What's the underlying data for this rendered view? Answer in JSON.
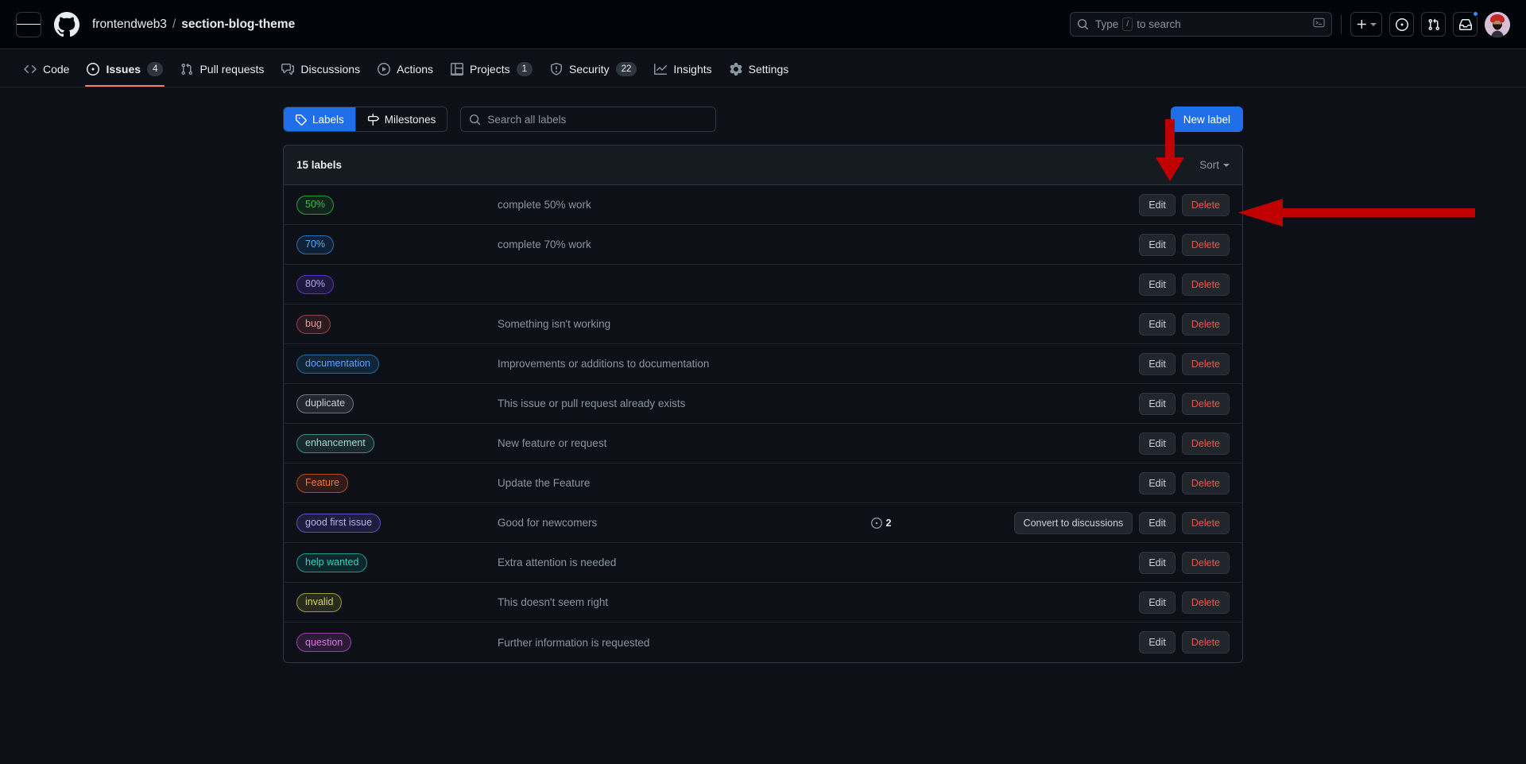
{
  "header": {
    "menu_icon": "hamburger-icon",
    "logo_icon": "github-mark-icon",
    "owner": "frontendweb3",
    "separator": "/",
    "repo": "section-blog-theme",
    "search": {
      "placeholder_prefix": "Type",
      "slash_key": "/",
      "placeholder_suffix": "to search",
      "terminal_icon": "terminal-chevron-icon"
    },
    "actions": {
      "create_new_icon": "plus-icon",
      "create_new_caret": "chevron-down-icon",
      "issues_icon": "issue-opened-icon",
      "pull_requests_icon": "git-pull-request-icon",
      "notifications_icon": "inbox-icon",
      "notification_badge": true,
      "avatar_icon": "user-avatar"
    }
  },
  "repo_nav": {
    "tabs": [
      {
        "label": "Code",
        "icon": "code-icon",
        "count": null,
        "active": false
      },
      {
        "label": "Issues",
        "icon": "issue-opened-icon",
        "count": "4",
        "active": true
      },
      {
        "label": "Pull requests",
        "icon": "git-pull-request-icon",
        "count": null,
        "active": false
      },
      {
        "label": "Discussions",
        "icon": "comment-discussion-icon",
        "count": null,
        "active": false
      },
      {
        "label": "Actions",
        "icon": "play-icon",
        "count": null,
        "active": false
      },
      {
        "label": "Projects",
        "icon": "table-icon",
        "count": "1",
        "active": false
      },
      {
        "label": "Security",
        "icon": "shield-icon",
        "count": "22",
        "active": false
      },
      {
        "label": "Insights",
        "icon": "graph-icon",
        "count": null,
        "active": false
      },
      {
        "label": "Settings",
        "icon": "gear-icon",
        "count": null,
        "active": false
      }
    ]
  },
  "toolbar": {
    "labels_tab": "Labels",
    "labels_icon": "tag-icon",
    "milestones_tab": "Milestones",
    "milestones_icon": "milestone-icon",
    "search_placeholder": "Search all labels",
    "search_icon": "search-icon",
    "search_value": "",
    "new_label_button": "New label"
  },
  "panel": {
    "count_text": "15 labels",
    "sort_label": "Sort",
    "sort_caret_icon": "chevron-down-icon"
  },
  "buttons": {
    "edit": "Edit",
    "delete": "Delete",
    "convert": "Convert to discussions"
  },
  "colors": {
    "accent_blue": "#1f6feb",
    "danger_red": "#f85149",
    "active_tab_underline": "#f78166",
    "annotation_red": "#c00000",
    "page_bg": "#0d1117",
    "header_bg": "#010409",
    "border": "#30363d"
  },
  "labels": [
    {
      "name": "50%",
      "description": "complete 50% work",
      "color": "#19a337",
      "text": "#3fb950",
      "bg": "rgba(25,163,55,0.14)",
      "issue_count": null,
      "convertible": false
    },
    {
      "name": "70%",
      "description": "complete 70% work",
      "color": "#1f6fc4",
      "text": "#58a6ff",
      "bg": "rgba(31,111,196,0.18)",
      "issue_count": null,
      "convertible": false
    },
    {
      "name": "80%",
      "description": "",
      "color": "#5a32c4",
      "text": "#b8a6f0",
      "bg": "rgba(90,50,196,0.22)",
      "issue_count": null,
      "convertible": false
    },
    {
      "name": "bug",
      "description": "Something isn't working",
      "color": "#96414a",
      "text": "#e09aa0",
      "bg": "rgba(150,65,74,0.22)",
      "issue_count": null,
      "convertible": false
    },
    {
      "name": "documentation",
      "description": "Improvements or additions to documentation",
      "color": "#1a6ea8",
      "text": "#58a6ff",
      "bg": "rgba(26,110,168,0.22)",
      "issue_count": null,
      "convertible": false
    },
    {
      "name": "duplicate",
      "description": "This issue or pull request already exists",
      "color": "#70777f",
      "text": "#c9d1d9",
      "bg": "rgba(112,119,127,0.22)",
      "issue_count": null,
      "convertible": false
    },
    {
      "name": "enhancement",
      "description": "New feature or request",
      "color": "#3f8a86",
      "text": "#a5d6d3",
      "bg": "rgba(63,138,134,0.20)",
      "issue_count": null,
      "convertible": false
    },
    {
      "name": "Feature",
      "description": "Update the Feature",
      "color": "#b84a1c",
      "text": "#f0733f",
      "bg": "rgba(184,74,28,0.20)",
      "issue_count": null,
      "convertible": false
    },
    {
      "name": "good first issue",
      "description": "Good for newcomers",
      "color": "#5b4fc4",
      "text": "#b3aef0",
      "bg": "rgba(91,79,196,0.22)",
      "issue_count": "2",
      "convertible": true
    },
    {
      "name": "help wanted",
      "description": "Extra attention is needed",
      "color": "#129e8f",
      "text": "#39d0c0",
      "bg": "rgba(18,158,143,0.16)",
      "issue_count": null,
      "convertible": false
    },
    {
      "name": "invalid",
      "description": "This doesn't seem right",
      "color": "#9a9a36",
      "text": "#d4d45c",
      "bg": "rgba(154,154,54,0.20)",
      "issue_count": null,
      "convertible": false
    },
    {
      "name": "question",
      "description": "Further information is requested",
      "color": "#9b3fa8",
      "text": "#da74e8",
      "bg": "rgba(155,63,168,0.22)",
      "issue_count": null,
      "convertible": false
    }
  ],
  "annotations": [
    {
      "name": "arrow-down",
      "direction": "down",
      "color": "#c00000",
      "target": "delete-button-row"
    },
    {
      "name": "arrow-left",
      "direction": "left",
      "color": "#c00000",
      "target": "delete-button"
    }
  ]
}
